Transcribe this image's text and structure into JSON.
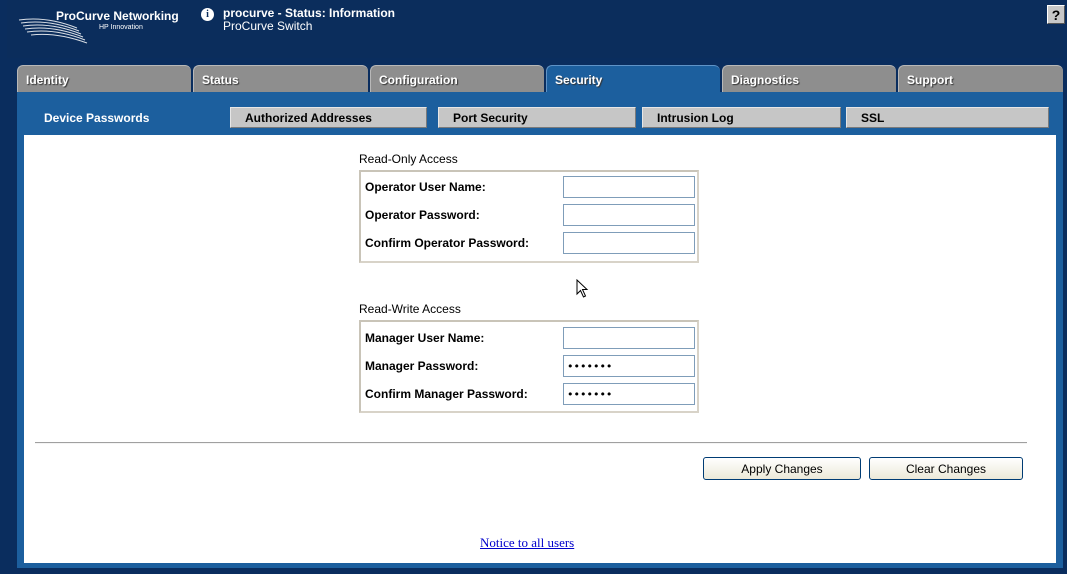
{
  "header": {
    "logo_title": "ProCurve Networking",
    "logo_subtitle": "HP Innovation",
    "status_title": "procurve - Status: Information",
    "status_subtitle": "ProCurve Switch",
    "help_label": "?",
    "info_icon": "info-icon",
    "help_icon": "question-mark-icon"
  },
  "main_tabs": [
    {
      "label": "Identity",
      "active": false
    },
    {
      "label": "Status",
      "active": false
    },
    {
      "label": "Configuration",
      "active": false
    },
    {
      "label": "Security",
      "active": true
    },
    {
      "label": "Diagnostics",
      "active": false
    },
    {
      "label": "Support",
      "active": false
    }
  ],
  "sub_tabs": [
    {
      "label": "Device Passwords",
      "active": true
    },
    {
      "label": "Authorized Addresses",
      "active": false
    },
    {
      "label": "Port Security",
      "active": false
    },
    {
      "label": "Intrusion Log",
      "active": false
    },
    {
      "label": "SSL",
      "active": false
    }
  ],
  "read_only": {
    "title": "Read-Only Access",
    "fields": [
      {
        "label": "Operator User Name:",
        "value": "",
        "type": "text"
      },
      {
        "label": "Operator Password:",
        "value": "",
        "type": "password"
      },
      {
        "label": "Confirm Operator Password:",
        "value": "",
        "type": "password"
      }
    ]
  },
  "read_write": {
    "title": "Read-Write Access",
    "fields": [
      {
        "label": "Manager User Name:",
        "value": "",
        "type": "text"
      },
      {
        "label": "Manager Password:",
        "value": "•••••••",
        "type": "password"
      },
      {
        "label": "Confirm Manager Password:",
        "value": "•••••••",
        "type": "password"
      }
    ]
  },
  "buttons": {
    "apply_label": "Apply Changes",
    "clear_label": "Clear Changes"
  },
  "footer": {
    "notice_link": "Notice to all users"
  },
  "colors": {
    "header_bg": "#0b2d5c",
    "active_tab": "#1c5f9e",
    "inactive_tab": "#8e8e8e",
    "subtab_bg": "#c6c6c6",
    "link": "#0000cc"
  }
}
